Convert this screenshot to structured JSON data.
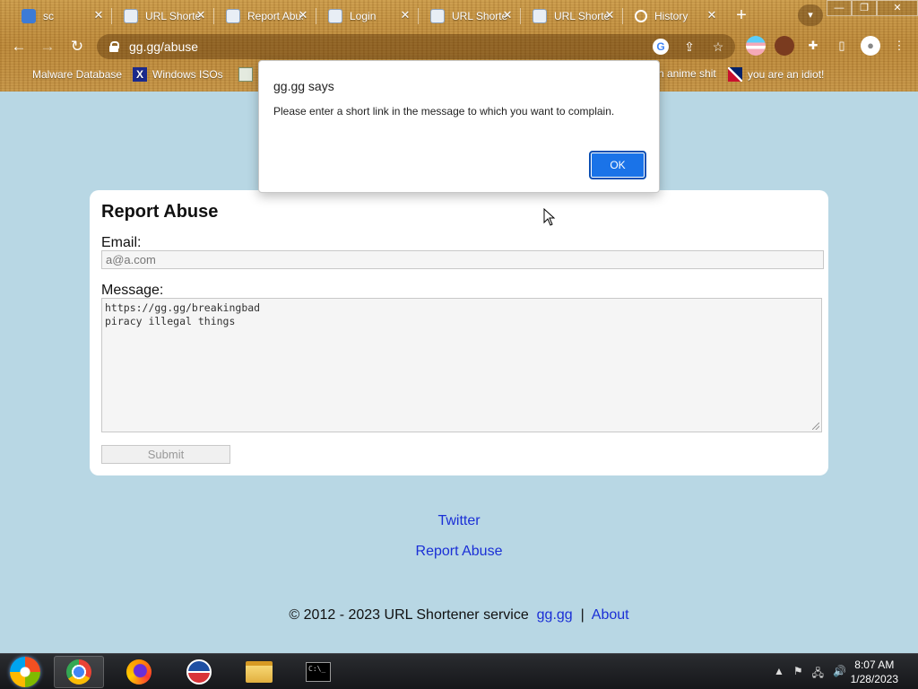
{
  "browser": {
    "tabs": [
      {
        "title": "sc",
        "favicon": "telegram-icon"
      },
      {
        "title": "URL Shortener",
        "favicon": "gear-icon"
      },
      {
        "title": "Report Abuse",
        "favicon": "gear-icon"
      },
      {
        "title": "Login",
        "favicon": "gear-icon"
      },
      {
        "title": "URL Shortener",
        "favicon": "gear-icon"
      },
      {
        "title": "URL Shortener",
        "favicon": "gear-icon"
      },
      {
        "title": "History",
        "favicon": "history-icon"
      }
    ],
    "address": "gg.gg/abuse",
    "bookmarks": [
      {
        "label": "Malware Database"
      },
      {
        "label": "Windows ISOs"
      },
      {
        "label": "n anime shit"
      },
      {
        "label": "you are an idiot!"
      }
    ]
  },
  "dialog": {
    "title": "gg.gg says",
    "message": "Please enter a short link in the message to which you want to complain.",
    "ok_label": "OK",
    "accent": "#1a73e8"
  },
  "form": {
    "heading": "Report Abuse",
    "email_label": "Email:",
    "email_value": "a@a.com",
    "message_label": "Message:",
    "message_value": "https://gg.gg/breakingbad\npiracy illegal things",
    "submit_label": "Submit"
  },
  "links": {
    "twitter": "Twitter",
    "report_abuse": "Report Abuse"
  },
  "footer": {
    "text": "© 2012 - 2023 URL Shortener service",
    "site_link": "gg.gg",
    "separator": "|",
    "about_link": "About"
  },
  "taskbar": {
    "time": "8:07 AM",
    "date": "1/28/2023"
  },
  "colors": {
    "page_bg": "#b8d7e4",
    "link": "#1a2fd6"
  }
}
